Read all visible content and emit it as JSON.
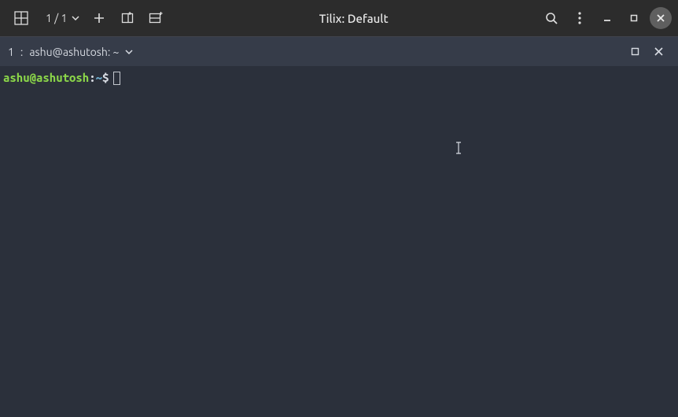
{
  "titlebar": {
    "session_counter": "1 / 1",
    "title": "Tilix: Default"
  },
  "tabbar": {
    "tab_index": "1",
    "tab_title": "ashu@ashutosh: ~"
  },
  "terminal": {
    "prompt_user_host": "ashu@ashutosh",
    "prompt_sep": ":",
    "prompt_path": "~",
    "prompt_symbol": "$",
    "input_value": ""
  }
}
